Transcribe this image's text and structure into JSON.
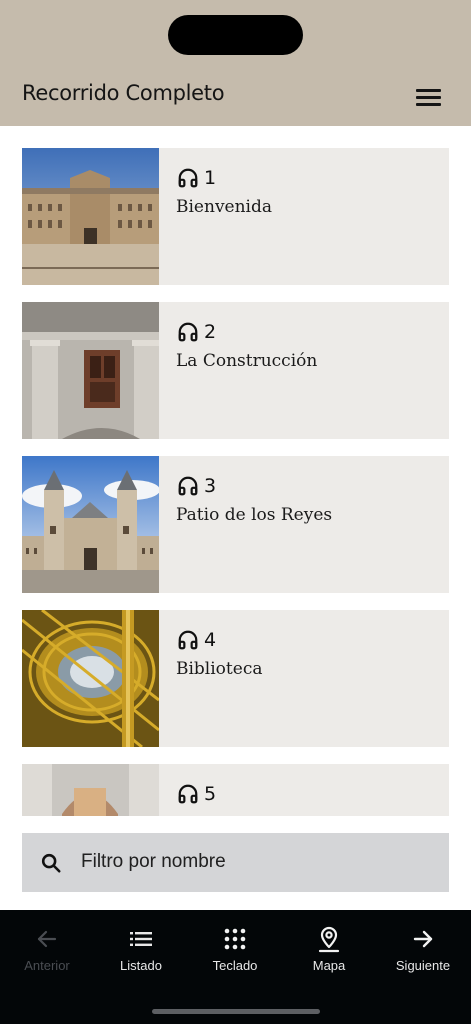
{
  "header": {
    "title": "Recorrido Completo",
    "menu_icon": "hamburger-menu-icon"
  },
  "stops": [
    {
      "number": "1",
      "title": "Bienvenida",
      "icon": "headphones-icon"
    },
    {
      "number": "2",
      "title": "La Construcción",
      "icon": "headphones-icon"
    },
    {
      "number": "3",
      "title": "Patio de los Reyes",
      "icon": "headphones-icon"
    },
    {
      "number": "4",
      "title": "Biblioteca",
      "icon": "headphones-icon"
    },
    {
      "number": "5",
      "title": "",
      "icon": "headphones-icon"
    }
  ],
  "filter": {
    "placeholder": "Filtro por nombre",
    "icon": "search-icon"
  },
  "bottom_nav": {
    "anterior": {
      "label": "Anterior",
      "icon": "arrow-left-icon",
      "enabled": false
    },
    "listado": {
      "label": "Listado",
      "icon": "list-icon",
      "enabled": true
    },
    "teclado": {
      "label": "Teclado",
      "icon": "keypad-icon",
      "enabled": true
    },
    "mapa": {
      "label": "Mapa",
      "icon": "map-pin-icon",
      "enabled": true
    },
    "siguiente": {
      "label": "Siguiente",
      "icon": "arrow-right-icon",
      "enabled": true
    }
  },
  "colors": {
    "header_bg": "#c5bbac",
    "card_bg": "#edebe8",
    "filter_bg": "#d4d5d7",
    "bottom_bar_bg": "#030608",
    "disabled": "#4a4d52"
  }
}
